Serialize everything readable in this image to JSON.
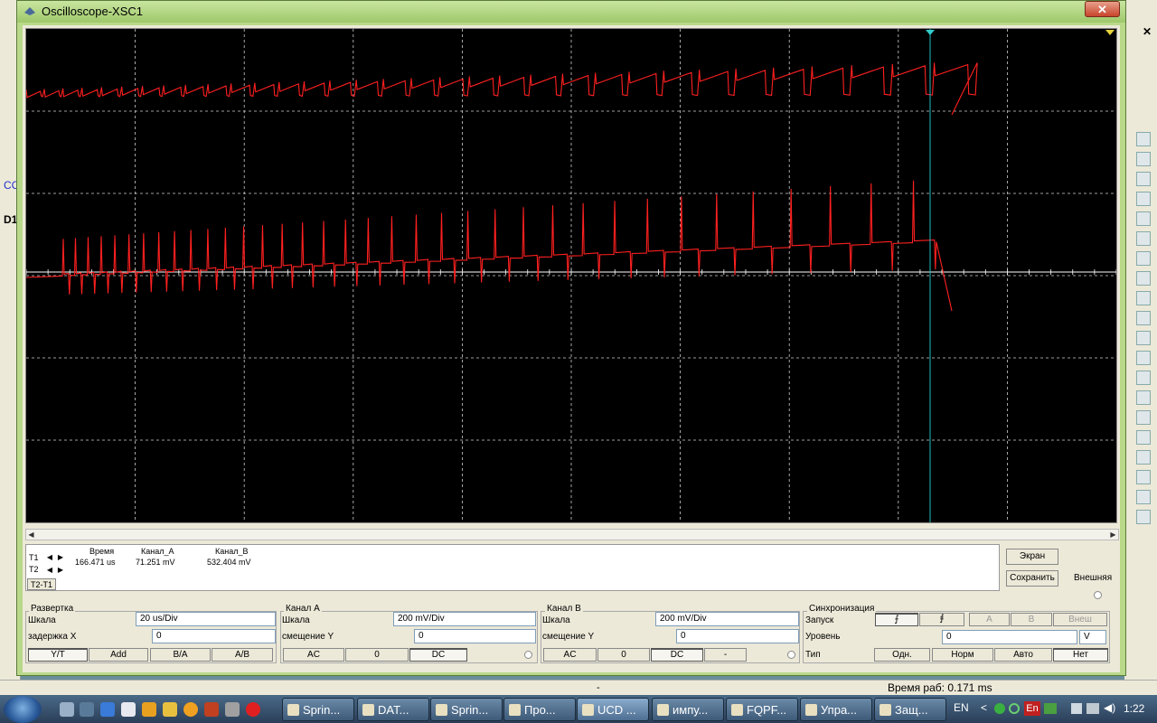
{
  "window": {
    "title": "Oscilloscope-XSC1",
    "close": "✕"
  },
  "readout": {
    "rows": [
      "T1",
      "T2"
    ],
    "diff_label": "T2-T1",
    "headers": [
      "Время",
      "Канал_A",
      "Канал_B"
    ],
    "values": [
      "166.471 us",
      "71.251 mV",
      "532.404 mV"
    ]
  },
  "buttons": {
    "screen": "Экран",
    "save": "Сохранить",
    "external": "Внешняя"
  },
  "timebase": {
    "title": "Развертка",
    "scale_label": "Шкала",
    "scale_value": "20 us/Div",
    "delay_label": "задержка X",
    "delay_value": "0",
    "modes": [
      "Y/T",
      "Add",
      "B/A",
      "A/B"
    ],
    "active_mode": "Y/T"
  },
  "channel_a": {
    "title": "Канал A",
    "scale_label": "Шкала",
    "scale_value": "200 mV/Div",
    "offset_label": "смещение Y",
    "offset_value": "0",
    "coupling": [
      "AC",
      "0",
      "DC"
    ],
    "active_coupling": "DC"
  },
  "channel_b": {
    "title": "Канал B",
    "scale_label": "Шкала",
    "scale_value": "200 mV/Div",
    "offset_label": "смещение Y",
    "offset_value": "0",
    "coupling": [
      "AC",
      "0",
      "DC",
      "-"
    ],
    "active_coupling": "DC"
  },
  "trigger": {
    "title": "Синхронизация",
    "edge_label": "Запуск",
    "sources": [
      "A",
      "B",
      "Внеш"
    ],
    "level_label": "Уровень",
    "level_value": "0",
    "level_unit": "V",
    "type_label": "Тип",
    "types": [
      "Одн.",
      "Норм",
      "Авто",
      "Нет"
    ],
    "active_type": "Нет"
  },
  "statusbar": {
    "left": "-",
    "runtime": "Время раб: 0.171 ms"
  },
  "taskbar": {
    "tasks": [
      "Sprin...",
      "DAT...",
      "Sprin...",
      "Про...",
      "UCD ...",
      "импу...",
      "FQPF...",
      "Упра...",
      "Защ..."
    ],
    "active_task": "UCD ...",
    "lang": "EN",
    "lang2": "En",
    "clock": "1:22"
  },
  "colors": {
    "trace": "#ff2020",
    "cursor": "#22bbbb",
    "grid": "#cfcfcf",
    "screen": "#000000"
  },
  "left_fragments": [
    "CC",
    "D1"
  ]
}
